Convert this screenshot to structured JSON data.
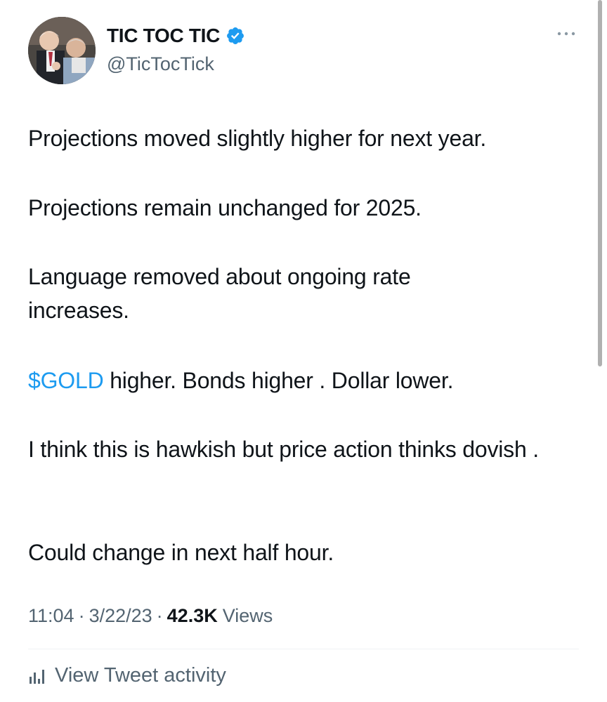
{
  "author": {
    "display_name": "TIC TOC TIC",
    "handle": "@TicTocTick",
    "verified": true,
    "avatar_icon": "avatar-photo"
  },
  "tweet": {
    "paragraphs": [
      "Projections moved slightly higher for next year.",
      "Projections remain unchanged for 2025.",
      "Language removed about ongoing rate increases.",
      "I think this is hawkish but price action thinks dovish .",
      "Could change in next half hour."
    ],
    "gold_line": {
      "cashtag": "$GOLD",
      "rest": " higher. Bonds higher . Dollar lower."
    }
  },
  "meta": {
    "time": "11:04",
    "date": "3/22/23",
    "separator": "·",
    "views_count": "42.3K",
    "views_label": "Views"
  },
  "actions": {
    "view_activity_label": "View Tweet activity",
    "more_icon": "more-horizontal-icon",
    "activity_icon": "bar-chart-icon"
  },
  "colors": {
    "accent": "#1d9bf0",
    "secondary_text": "#536471",
    "primary_text": "#0f1419"
  }
}
